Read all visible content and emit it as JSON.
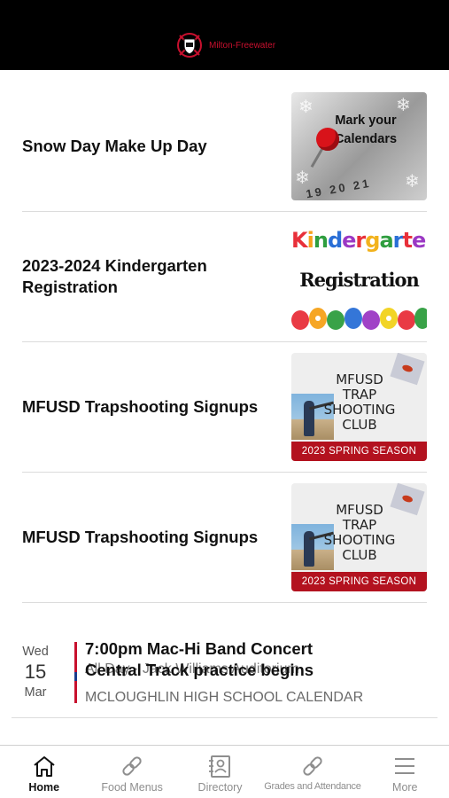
{
  "header": {
    "brand_name": "Milton-Freewater",
    "logo_icon": "shield-crest-icon",
    "accent_color": "#c8102e"
  },
  "news": [
    {
      "title": "Snow Day Make Up Day",
      "thumb_text": "Mark your Calendars",
      "thumb_calendar_digits": "19  20  21"
    },
    {
      "title": "2023-2024 Kindergarten Registration",
      "thumb_line1": "Kindergarten",
      "thumb_line2": "Registration"
    },
    {
      "title": "MFUSD Trapshooting Signups",
      "thumb_text": "MFUSD TRAP SHOOTING CLUB",
      "thumb_band": "2023 SPRING SEASON"
    },
    {
      "title": "MFUSD Trapshooting Signups",
      "thumb_text": "MFUSD TRAP SHOOTING CLUB",
      "thumb_band": "2023 SPRING SEASON"
    }
  ],
  "events": [
    {
      "dow": "Wed",
      "day": "15",
      "month": "Mar",
      "title": "7:00pm Mac-Hi Band Concert",
      "meta": "All Day · Jack Williams Auditorium",
      "calendar": "MCLOUGHLIN HIGH SCHOOL CALENDAR"
    },
    {
      "title": "Central Track practice begins"
    }
  ],
  "tabs": [
    {
      "label": "Home",
      "icon": "home-icon",
      "active": true
    },
    {
      "label": "Food Menus",
      "icon": "link-icon",
      "active": false
    },
    {
      "label": "Directory",
      "icon": "contact-card-icon",
      "active": false
    },
    {
      "label": "Grades and Attendance",
      "icon": "link-icon",
      "active": false
    },
    {
      "label": "More",
      "icon": "menu-icon",
      "active": false
    }
  ]
}
